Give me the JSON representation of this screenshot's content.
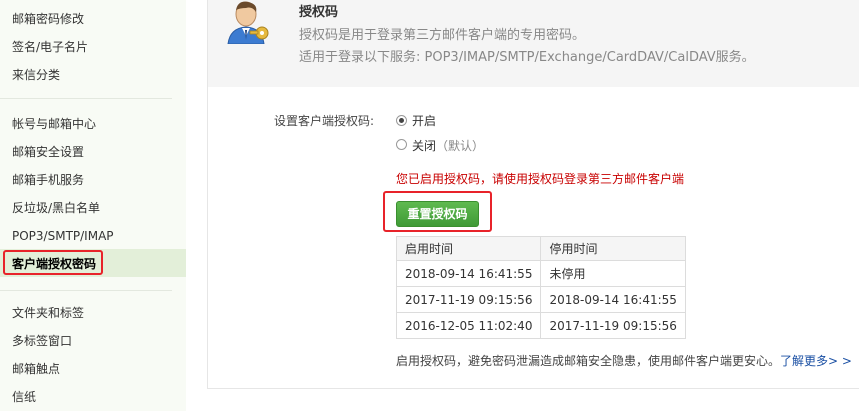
{
  "sidebar": {
    "items_top": [
      "邮箱密码修改",
      "签名/电子名片",
      "来信分类"
    ],
    "items_mid": [
      "帐号与邮箱中心",
      "邮箱安全设置",
      "邮箱手机服务",
      "反垃圾/黑白名单",
      "POP3/SMTP/IMAP"
    ],
    "active_item": "客户端授权密码",
    "items_bottom": [
      "文件夹和标签",
      "多标签窗口",
      "邮箱触点",
      "信纸"
    ]
  },
  "header": {
    "title": "授权码",
    "description_1": "授权码是用于登录第三方邮件客户端的专用密码。",
    "description_2": "适用于登录以下服务: POP3/IMAP/SMTP/Exchange/CardDAV/CalDAV服务。"
  },
  "settings": {
    "label": "设置客户端授权码:",
    "option_on": "开启",
    "option_off": "关闭",
    "option_off_hint": "（默认）",
    "selected": "开启",
    "notice": "您已启用授权码，请使用授权码登录第三方邮件客户端",
    "reset_button": "重置授权码"
  },
  "log_table": {
    "headers": [
      "启用时间",
      "停用时间"
    ],
    "rows": [
      [
        "2018-09-14 16:41:55",
        "未停用"
      ],
      [
        "2017-11-19 09:15:56",
        "2018-09-14 16:41:55"
      ],
      [
        "2016-12-05 11:02:40",
        "2017-11-19 09:15:56"
      ]
    ]
  },
  "footer": {
    "text": "启用授权码，避免密码泄漏造成邮箱安全隐患，使用邮件客户端更安心。",
    "link": "了解更多> >"
  },
  "colors": {
    "highlight_border": "#e8232a",
    "button_green": "#4aa83f",
    "notice_red": "#c80000",
    "link_blue": "#1a4fa3"
  }
}
